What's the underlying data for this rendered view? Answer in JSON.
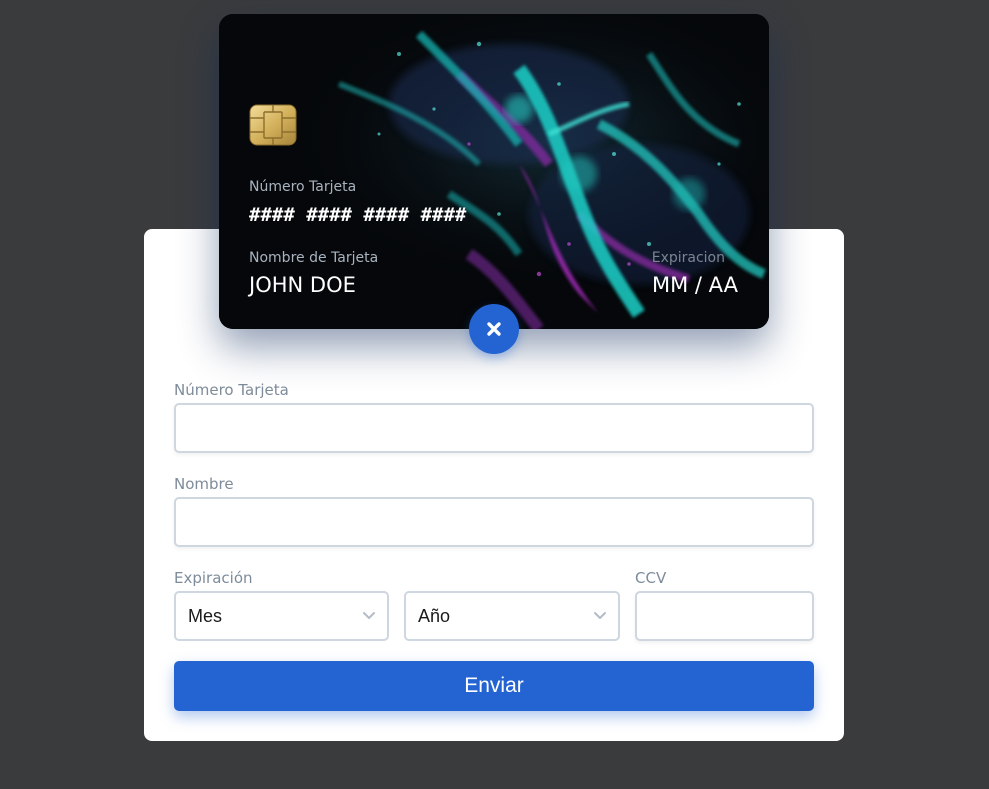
{
  "card": {
    "number_label": "Número Tarjeta",
    "number_value": "#### #### #### ####",
    "name_label": "Nombre de Tarjeta",
    "name_value": "JOHN DOE",
    "expiry_label": "Expiracion",
    "expiry_value": "MM / AA"
  },
  "toggle": {
    "icon": "close-icon"
  },
  "form": {
    "card_number": {
      "label": "Número Tarjeta",
      "value": "",
      "placeholder": ""
    },
    "name": {
      "label": "Nombre",
      "value": "",
      "placeholder": ""
    },
    "expiry": {
      "label": "Expiración",
      "month_selected": "Mes",
      "year_selected": "Año"
    },
    "ccv": {
      "label": "CCV",
      "value": "",
      "placeholder": ""
    },
    "submit_label": "Enviar"
  },
  "colors": {
    "background": "#3a3b3d",
    "panel": "#ffffff",
    "accent": "#2364d2",
    "input_border": "#ced6e0",
    "label": "#7e8b9a"
  }
}
